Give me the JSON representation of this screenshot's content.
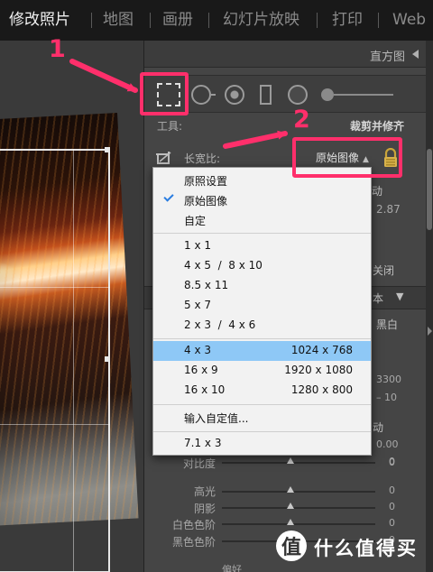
{
  "topbar": {
    "tabs": [
      {
        "label": "修改照片",
        "active": true
      },
      {
        "label": "地图",
        "active": false
      },
      {
        "label": "画册",
        "active": false
      },
      {
        "label": "幻灯片放映",
        "active": false
      },
      {
        "label": "打印",
        "active": false
      },
      {
        "label": "Web",
        "active": false
      }
    ]
  },
  "panel": {
    "histogram_title": "直方图",
    "tools_label": "工具:",
    "crop_label": "裁剪并修齐",
    "aspect_label": "长宽比:",
    "aspect_value": "原始图像",
    "partial": {
      "auto1": "动",
      "val_287": "2.87",
      "close": "关闭",
      "basic": "本",
      "bw": "黑白",
      "temp": "3300",
      "tint": "– 10",
      "auto2": "动",
      "val_000": "0.00",
      "zero": "0"
    },
    "sliders": [
      {
        "label": "对比度",
        "value": "0"
      },
      {
        "label": "高光",
        "value": "0"
      },
      {
        "label": "阴影",
        "value": "0"
      },
      {
        "label": "白色色阶",
        "value": "0"
      },
      {
        "label": "黑色色阶",
        "value": "0"
      }
    ],
    "bottom_label": "偏好"
  },
  "menu": {
    "groups": [
      [
        {
          "label": "原照设置",
          "right": ""
        },
        {
          "label": "原始图像",
          "right": "",
          "checked": true
        },
        {
          "label": "自定",
          "right": ""
        }
      ],
      [
        {
          "label": "1 x 1",
          "right": ""
        },
        {
          "label": "4 x 5  /  8 x 10",
          "right": ""
        },
        {
          "label": "8.5 x 11",
          "right": ""
        },
        {
          "label": "5 x 7",
          "right": ""
        },
        {
          "label": "2 x 3  /  4 x 6",
          "right": ""
        }
      ],
      [
        {
          "label": "4 x 3",
          "right": "1024 x 768",
          "highlighted": true
        },
        {
          "label": "16 x 9",
          "right": "1920 x 1080"
        },
        {
          "label": "16 x 10",
          "right": "1280 x 800"
        }
      ],
      [
        {
          "label": "输入自定值...",
          "right": ""
        }
      ],
      [
        {
          "label": "7.1 x 3",
          "right": ""
        }
      ]
    ]
  },
  "annotations": {
    "step1": "1",
    "step2": "2",
    "color": "#ff2f6b"
  },
  "watermark": {
    "logo": "值",
    "text": "什么值得买"
  },
  "colors": {
    "topbar_bg": "#191919",
    "panel_bg": "#454545",
    "menu_bg": "#f2f2f2",
    "menu_highlight": "#8ec8f6",
    "accent": "#ff2f6b"
  }
}
